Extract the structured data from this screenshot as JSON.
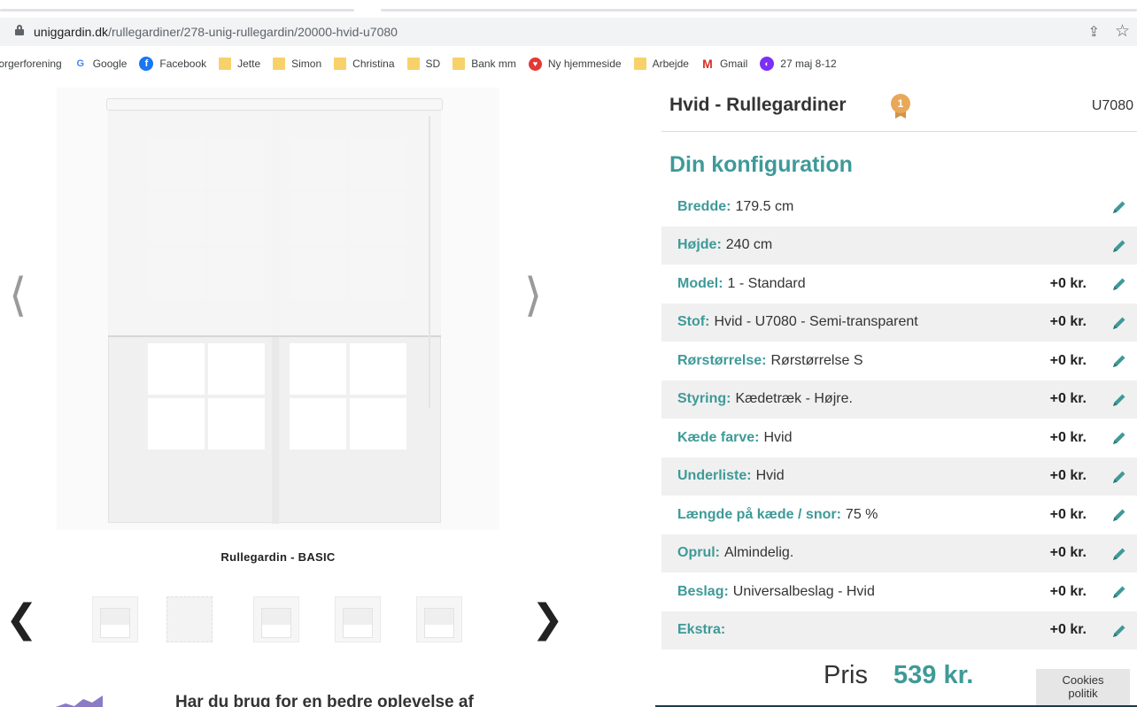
{
  "browser": {
    "url_host": "uniggardin.dk",
    "url_path": "/rullegardiner/278-unig-rullegardin/20000-hvid-u7080",
    "bookmarks": [
      {
        "label": "ɔrgerforening",
        "icon": "none"
      },
      {
        "label": "Google",
        "icon": "google-icon"
      },
      {
        "label": "Facebook",
        "icon": "facebook-icon"
      },
      {
        "label": "Jette",
        "icon": "folder-icon"
      },
      {
        "label": "Simon",
        "icon": "folder-icon"
      },
      {
        "label": "Christina",
        "icon": "folder-icon"
      },
      {
        "label": "SD",
        "icon": "folder-icon"
      },
      {
        "label": "Bank mm",
        "icon": "folder-icon"
      },
      {
        "label": "Ny hjemmeside",
        "icon": "heart-icon"
      },
      {
        "label": "Arbejde",
        "icon": "folder-icon"
      },
      {
        "label": "Gmail",
        "icon": "gmail-icon"
      },
      {
        "label": "27 maj 8-12",
        "icon": "circle-icon"
      }
    ]
  },
  "gallery": {
    "caption": "Rullegardin - BASIC",
    "prev_glyph": "⟨",
    "next_glyph": "⟩",
    "thumbs_prev_glyph": "❮",
    "thumbs_next_glyph": "❯",
    "promo_text": "Har du brug for en bedre oplevelse af"
  },
  "product": {
    "title": "Hvid - Rullegardiner",
    "medal_number": "1",
    "sku": "U7080",
    "config_heading": "Din konfiguration"
  },
  "config_rows": [
    {
      "label": "Bredde:",
      "value": "179.5 cm",
      "price": ""
    },
    {
      "label": "Højde:",
      "value": "240 cm",
      "price": ""
    },
    {
      "label": "Model:",
      "value": "1 - Standard",
      "price": "+0 kr."
    },
    {
      "label": "Stof:",
      "value": "Hvid - U7080 - Semi-transparent",
      "price": "+0 kr."
    },
    {
      "label": "Rørstørrelse:",
      "value": "Rørstørrelse S",
      "price": "+0 kr."
    },
    {
      "label": "Styring:",
      "value": "Kædetræk - Højre.",
      "price": "+0 kr."
    },
    {
      "label": "Kæde farve:",
      "value": "Hvid",
      "price": "+0 kr."
    },
    {
      "label": "Underliste:",
      "value": "Hvid",
      "price": "+0 kr."
    },
    {
      "label": "Længde på kæde / snor:",
      "value": "75 %",
      "price": "+0 kr."
    },
    {
      "label": "Oprul:",
      "value": "Almindelig.",
      "price": "+0 kr."
    },
    {
      "label": "Beslag:",
      "value": "Universalbeslag - Hvid",
      "price": "+0 kr."
    },
    {
      "label": "Ekstra:",
      "value": "",
      "price": "+0 kr."
    }
  ],
  "price": {
    "label": "Pris",
    "value": "539 kr."
  },
  "cookies": {
    "line1": "Cookies",
    "line2": "politik"
  },
  "colors": {
    "accent": "#3e9a98",
    "row_alt": "#f0f0f0",
    "medal": "#e8a85a"
  }
}
